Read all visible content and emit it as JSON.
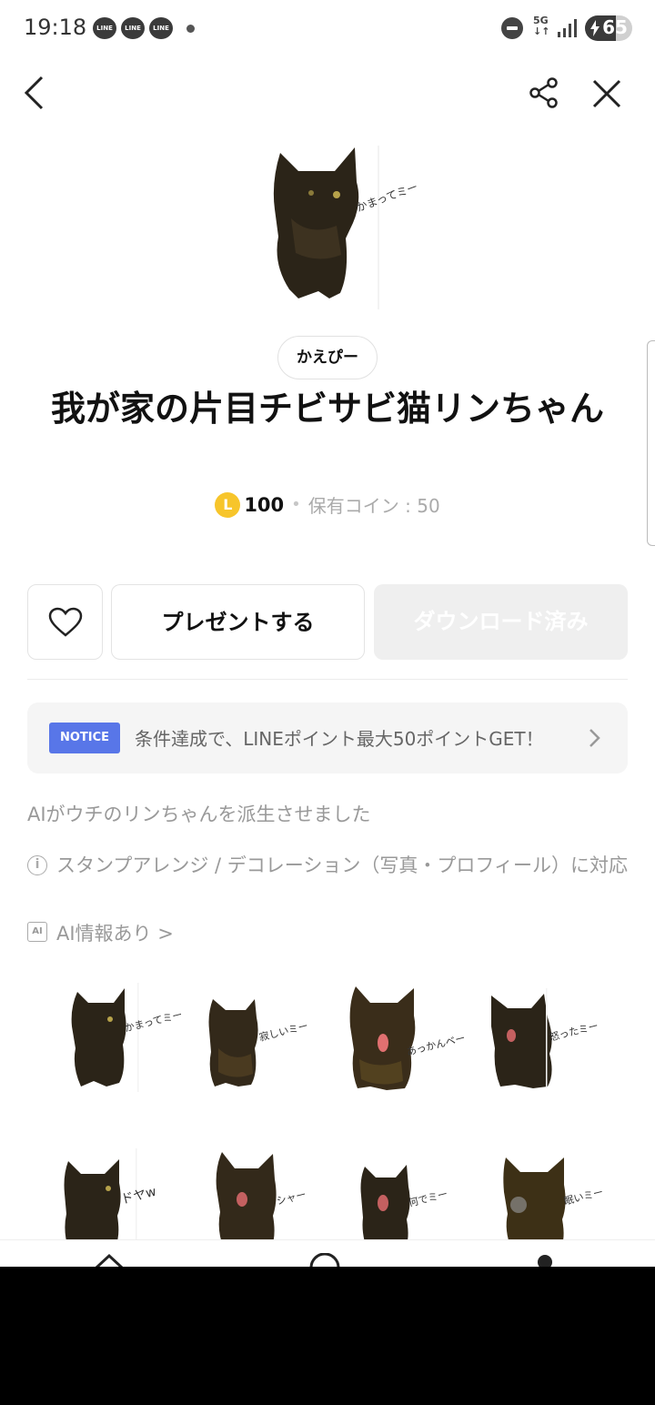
{
  "status_bar": {
    "time": "19:18",
    "line_badges": [
      "LINE",
      "LINE",
      "LINE"
    ],
    "network": "5G",
    "battery": "65",
    "battery_level_pct": 65
  },
  "header": {
    "back_icon": "chevron-left-icon",
    "share_icon": "share-icon",
    "close_icon": "close-icon"
  },
  "sticker": {
    "main_caption": "かまってミー",
    "author": "かえぴー",
    "title": "我が家の片目チビサビ猫リンちゃん",
    "price": "100",
    "coin_symbol": "L",
    "owned_coins": "保有コイン : 50"
  },
  "actions": {
    "favorite_icon": "heart-icon",
    "present_label": "プレゼントする",
    "download_label": "ダウンロード済み"
  },
  "notice": {
    "badge": "NOTICE",
    "text": "条件達成で、LINEポイント最大50ポイントGET！"
  },
  "description": "AIがウチのリンちゃんを派生させました",
  "info": {
    "arrange": "スタンプアレンジ / デコレーション（写真・プロフィール）に対応",
    "ai_badge": "AI",
    "ai_info": "AI情報あり >"
  },
  "grid": [
    {
      "caption": "かまってミー"
    },
    {
      "caption": "寂しいミー"
    },
    {
      "caption": "あっかんベー"
    },
    {
      "caption": "怒ったミー"
    },
    {
      "caption": "ドヤw"
    },
    {
      "caption": "シャー"
    },
    {
      "caption": "何でミー"
    },
    {
      "caption": "眠いミー"
    }
  ],
  "colors": {
    "notice_badge": "#5876e8",
    "coin": "#f7c52b",
    "download_bg": "#efefef"
  }
}
